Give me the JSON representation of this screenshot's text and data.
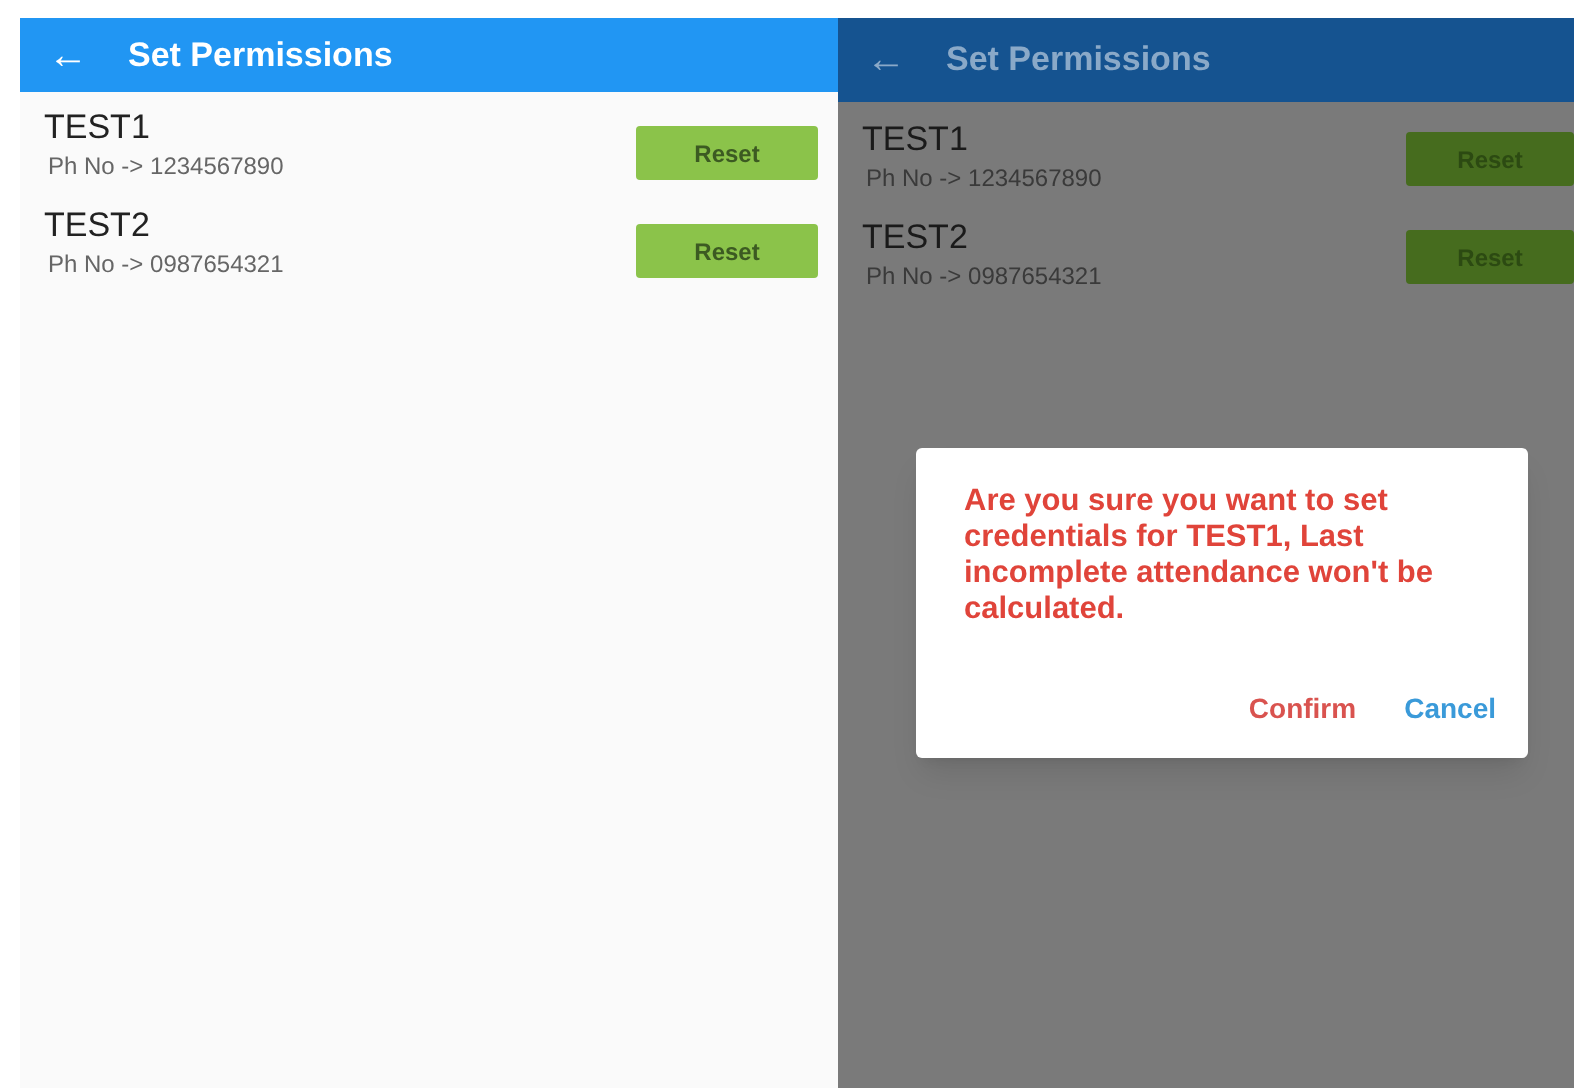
{
  "screens": [
    {
      "title": "Set Permissions",
      "back": "←",
      "dimmed": false,
      "rows": [
        {
          "name": "TEST1",
          "phone": "Ph No -> 1234567890",
          "button": "Reset"
        },
        {
          "name": "TEST2",
          "phone": "Ph No -> 0987654321",
          "button": "Reset"
        }
      ]
    },
    {
      "title": "Set Permissions",
      "back": "←",
      "dimmed": true,
      "rows": [
        {
          "name": "TEST1",
          "phone": "Ph No -> 1234567890",
          "button": "Reset"
        },
        {
          "name": "TEST2",
          "phone": "Ph No -> 0987654321",
          "button": "Reset"
        }
      ],
      "dialog": {
        "message": "Are you sure you want to set credentials for TEST1, Last incomplete attendance won't be calculated.",
        "buttons": [
          {
            "label": "Confirm",
            "kind": "confirm"
          },
          {
            "label": "Cancel",
            "kind": "cancel"
          }
        ]
      }
    }
  ]
}
